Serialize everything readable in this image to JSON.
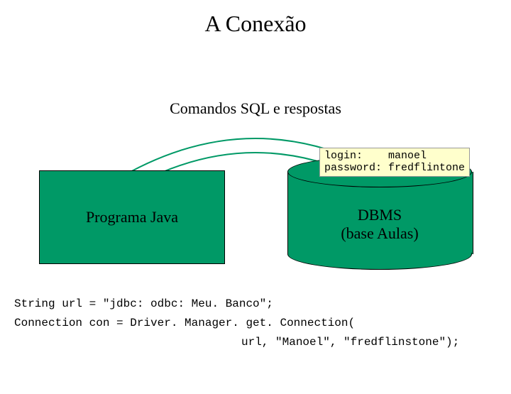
{
  "title": "A Conexão",
  "arc_label": "Comandos SQL e respostas",
  "java_box": "Programa Java",
  "dbms": {
    "line1": "DBMS",
    "line2": "(base Aulas)"
  },
  "credentials": {
    "login_label": "login:",
    "login_value": "manoel",
    "password_label": "password:",
    "password_value": "fredflintone"
  },
  "code": {
    "line1": "String url = \"jdbc: odbc: Meu. Banco\";",
    "line2": "Connection con = Driver. Manager. get. Connection(",
    "line3": "url, \"Manoel\", \"fredflinstone\");"
  }
}
